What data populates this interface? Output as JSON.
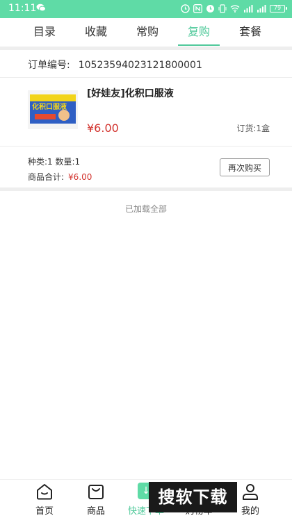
{
  "status_bar": {
    "time": "11:11",
    "battery": "79"
  },
  "tabs": [
    {
      "label": "目录",
      "active": false
    },
    {
      "label": "收藏",
      "active": false
    },
    {
      "label": "常购",
      "active": false
    },
    {
      "label": "复购",
      "active": true
    },
    {
      "label": "套餐",
      "active": false
    }
  ],
  "order": {
    "number_label": "订单编号:",
    "number": "10523594023121800001",
    "product": {
      "name": "[好娃友]化积口服液",
      "price": "¥6.00",
      "quantity": "订货:1盒",
      "image_text": "化积口服液"
    },
    "summary": {
      "types_quantity": "种类:1  数量:1",
      "total_label": "商品合计:",
      "total_price": "¥6.00"
    },
    "reorder_label": "再次购买"
  },
  "list_footer": "已加载全部",
  "bottom_nav": [
    {
      "label": "首页",
      "icon": "home-icon"
    },
    {
      "label": "商品",
      "icon": "bag-icon"
    },
    {
      "label": "快速下单",
      "icon": "quick-order-icon",
      "active": true
    },
    {
      "label": "购物车",
      "icon": "cart-icon"
    },
    {
      "label": "我的",
      "icon": "user-icon"
    }
  ],
  "watermark": "搜软下载",
  "colors": {
    "accent": "#5fdba6",
    "price": "#d2322d"
  }
}
